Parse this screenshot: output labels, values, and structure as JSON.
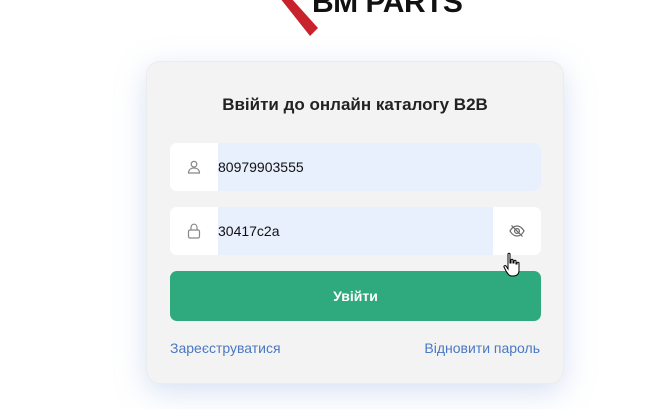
{
  "logo": {
    "text": "BM PARTS",
    "brand_color": "#c8232c"
  },
  "login": {
    "title": "Ввійти до онлайн каталогу B2B",
    "phone_value": "80979903555",
    "password_value": "30417c2a",
    "submit_label": "Увійти",
    "register_label": "Зареєструватися",
    "restore_label": "Відновити пароль"
  },
  "colors": {
    "accent": "#2eaa7e",
    "link": "#4a78c2",
    "input_fill": "#e8f0fe"
  },
  "icons": {
    "phone_field": "user-icon",
    "password_field": "lock-icon",
    "toggle": "eye-off-icon"
  }
}
